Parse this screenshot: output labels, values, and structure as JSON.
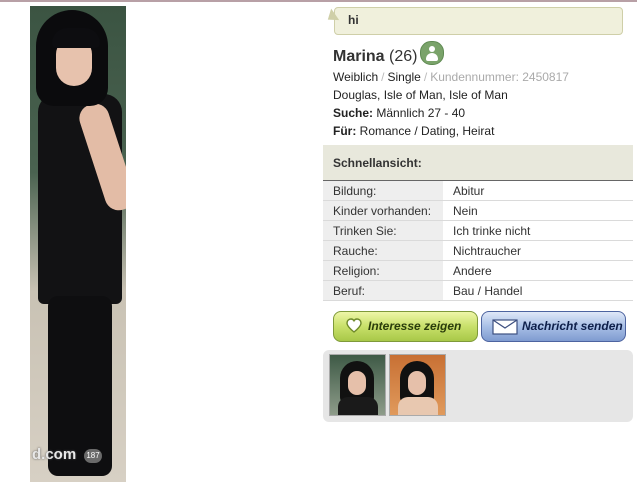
{
  "main_photo": {
    "watermark": "d.com",
    "badge": "187"
  },
  "message_bubble": {
    "text": "hi"
  },
  "profile": {
    "name": "Marina",
    "age_text": "(26)",
    "gender": "Weiblich",
    "status": "Single",
    "customer_number": "Kundennummer: 2450817",
    "location": "Douglas, Isle of Man, Isle of Man",
    "search_label": "Suche:",
    "search_value": "Männlich 27 - 40",
    "for_label": "Für:",
    "for_value": "Romance / Dating, Heirat"
  },
  "quick_view": {
    "title": "Schnellansicht:",
    "rows": [
      {
        "label": "Bildung:",
        "value": "Abitur"
      },
      {
        "label": "Kinder vorhanden:",
        "value": "Nein"
      },
      {
        "label": "Trinken Sie:",
        "value": "Ich trinke nicht"
      },
      {
        "label": "Rauche:",
        "value": "Nichtraucher"
      },
      {
        "label": "Religion:",
        "value": "Andere"
      },
      {
        "label": "Beruf:",
        "value": "Bau / Handel"
      }
    ]
  },
  "buttons": {
    "interest_label": "Interesse zeigen",
    "message_label": "Nachricht senden"
  },
  "icons": {
    "user_status": "user-silhouette-icon",
    "interest": "heart-icon",
    "message": "envelope-icon"
  },
  "colors": {
    "interest_button": "#c8e06a",
    "message_button": "#a8bfe6",
    "quick_view_header": "#e8e8dc"
  }
}
